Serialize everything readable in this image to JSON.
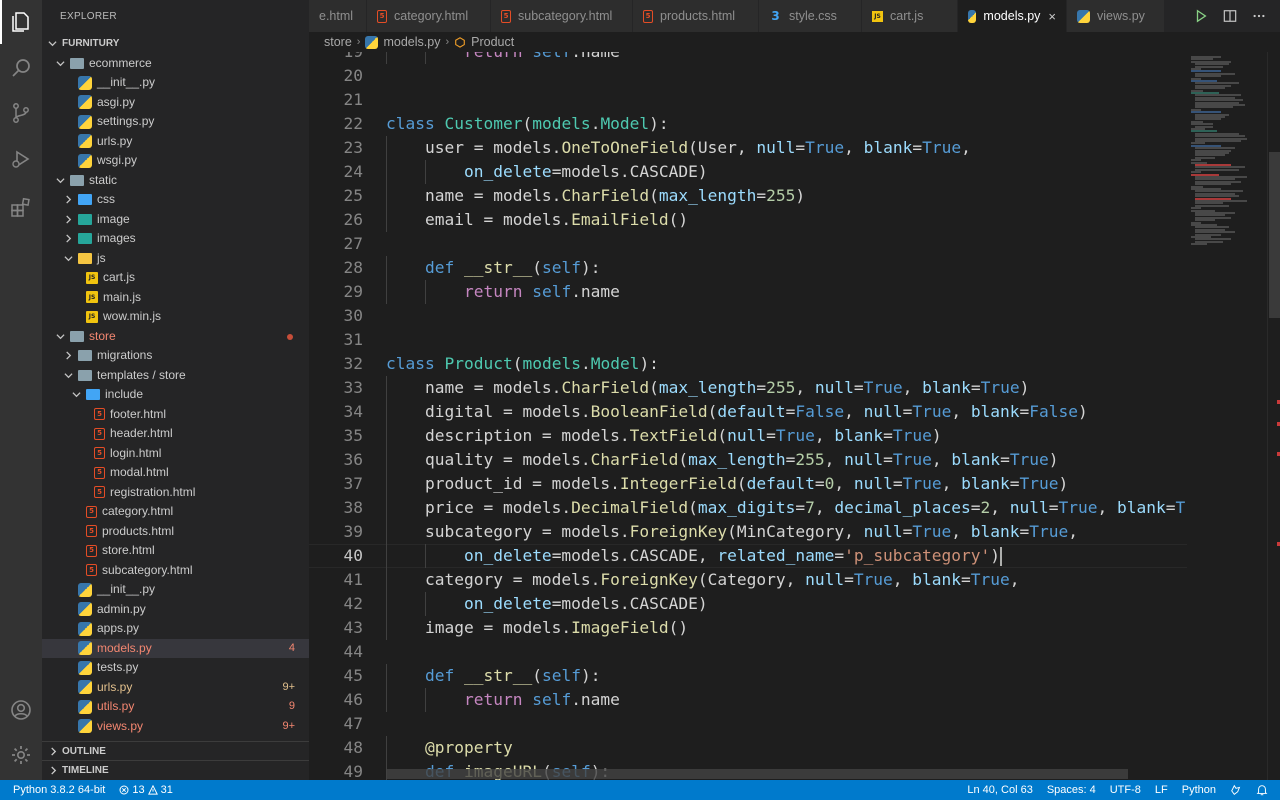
{
  "explorer": {
    "title": "EXPLORER",
    "tree": [
      {
        "label": "FURNITURY",
        "depth": 0,
        "type": "root",
        "open": true
      },
      {
        "label": "ecommerce",
        "depth": 1,
        "type": "folder",
        "icon": "folder-icon",
        "open": true
      },
      {
        "label": "__init__.py",
        "depth": 2,
        "type": "py"
      },
      {
        "label": "asgi.py",
        "depth": 2,
        "type": "py"
      },
      {
        "label": "settings.py",
        "depth": 2,
        "type": "py"
      },
      {
        "label": "urls.py",
        "depth": 2,
        "type": "py"
      },
      {
        "label": "wsgi.py",
        "depth": 2,
        "type": "py"
      },
      {
        "label": "static",
        "depth": 1,
        "type": "folder",
        "open": true
      },
      {
        "label": "css",
        "depth": 2,
        "type": "folder",
        "folder_color": "blue",
        "open": false
      },
      {
        "label": "image",
        "depth": 2,
        "type": "folder",
        "folder_color": "teal",
        "open": false
      },
      {
        "label": "images",
        "depth": 2,
        "type": "folder",
        "folder_color": "teal",
        "open": false
      },
      {
        "label": "js",
        "depth": 2,
        "type": "folder",
        "folder_color": "yellow",
        "open": true
      },
      {
        "label": "cart.js",
        "depth": 3,
        "type": "js"
      },
      {
        "label": "main.js",
        "depth": 3,
        "type": "js"
      },
      {
        "label": "wow.min.js",
        "depth": 3,
        "type": "js"
      },
      {
        "label": "store",
        "depth": 1,
        "type": "folder",
        "open": true,
        "status": "red",
        "dot": true
      },
      {
        "label": "migrations",
        "depth": 2,
        "type": "folder",
        "open": false
      },
      {
        "label": "templates / store",
        "depth": 2,
        "type": "folder",
        "open": true
      },
      {
        "label": "include",
        "depth": 3,
        "type": "folder",
        "folder_color": "blue",
        "open": true
      },
      {
        "label": "footer.html",
        "depth": 4,
        "type": "html"
      },
      {
        "label": "header.html",
        "depth": 4,
        "type": "html"
      },
      {
        "label": "login.html",
        "depth": 4,
        "type": "html"
      },
      {
        "label": "modal.html",
        "depth": 4,
        "type": "html"
      },
      {
        "label": "registration.html",
        "depth": 4,
        "type": "html"
      },
      {
        "label": "category.html",
        "depth": 3,
        "type": "html"
      },
      {
        "label": "products.html",
        "depth": 3,
        "type": "html"
      },
      {
        "label": "store.html",
        "depth": 3,
        "type": "html"
      },
      {
        "label": "subcategory.html",
        "depth": 3,
        "type": "html"
      },
      {
        "label": "__init__.py",
        "depth": 2,
        "type": "py"
      },
      {
        "label": "admin.py",
        "depth": 2,
        "type": "py"
      },
      {
        "label": "apps.py",
        "depth": 2,
        "type": "py"
      },
      {
        "label": "models.py",
        "depth": 2,
        "type": "py",
        "status": "red",
        "badge": "4",
        "selected": true
      },
      {
        "label": "tests.py",
        "depth": 2,
        "type": "py"
      },
      {
        "label": "urls.py",
        "depth": 2,
        "type": "py",
        "status": "yellow",
        "badge": "9+"
      },
      {
        "label": "utils.py",
        "depth": 2,
        "type": "py",
        "status": "red",
        "badge": "9"
      },
      {
        "label": "views.py",
        "depth": 2,
        "type": "py",
        "status": "red",
        "badge": "9+"
      }
    ],
    "sections": [
      {
        "label": "OUTLINE"
      },
      {
        "label": "TIMELINE"
      }
    ]
  },
  "tabs": [
    {
      "label": "e.html",
      "type": "html"
    },
    {
      "label": "category.html",
      "type": "html"
    },
    {
      "label": "subcategory.html",
      "type": "html"
    },
    {
      "label": "products.html",
      "type": "html"
    },
    {
      "label": "style.css",
      "type": "css"
    },
    {
      "label": "cart.js",
      "type": "js"
    },
    {
      "label": "models.py",
      "type": "py",
      "active": true
    },
    {
      "label": "views.py",
      "type": "py"
    }
  ],
  "breadcrumb": {
    "parts": [
      "store",
      "models.py",
      "Product"
    ]
  },
  "editor": {
    "current_line": 40,
    "lines": [
      {
        "n": 19,
        "tokens": [
          [
            "        ",
            ""
          ],
          [
            "return",
            "ctrl"
          ],
          [
            " ",
            ""
          ],
          [
            "self",
            "self"
          ],
          [
            ".name",
            ""
          ]
        ]
      },
      {
        "n": 20,
        "tokens": []
      },
      {
        "n": 21,
        "tokens": []
      },
      {
        "n": 22,
        "tokens": [
          [
            "class",
            "kw"
          ],
          [
            " ",
            ""
          ],
          [
            "Customer",
            "cls"
          ],
          [
            "(",
            ""
          ],
          [
            "models",
            "cls"
          ],
          [
            ".",
            ""
          ],
          [
            "Model",
            "cls"
          ],
          [
            "):",
            ""
          ]
        ]
      },
      {
        "n": 23,
        "tokens": [
          [
            "    user = models.",
            ""
          ],
          [
            "OneToOneField",
            "fn"
          ],
          [
            "(User, ",
            ""
          ],
          [
            "null",
            "par"
          ],
          [
            "=",
            ""
          ],
          [
            "True",
            "const"
          ],
          [
            ", ",
            ""
          ],
          [
            "blank",
            "par"
          ],
          [
            "=",
            ""
          ],
          [
            "True",
            "const"
          ],
          [
            ",",
            ""
          ]
        ]
      },
      {
        "n": 24,
        "tokens": [
          [
            "        ",
            ""
          ],
          [
            "on_delete",
            "par"
          ],
          [
            "=models.CASCADE)",
            ""
          ]
        ]
      },
      {
        "n": 25,
        "tokens": [
          [
            "    name = models.",
            ""
          ],
          [
            "CharField",
            "fn"
          ],
          [
            "(",
            ""
          ],
          [
            "max_length",
            "par"
          ],
          [
            "=",
            ""
          ],
          [
            "255",
            "num"
          ],
          [
            ")",
            ""
          ]
        ]
      },
      {
        "n": 26,
        "tokens": [
          [
            "    email = models.",
            ""
          ],
          [
            "EmailField",
            "fn"
          ],
          [
            "()",
            ""
          ]
        ]
      },
      {
        "n": 27,
        "tokens": []
      },
      {
        "n": 28,
        "tokens": [
          [
            "    ",
            ""
          ],
          [
            "def",
            "kw"
          ],
          [
            " ",
            ""
          ],
          [
            "__str__",
            "fn"
          ],
          [
            "(",
            ""
          ],
          [
            "self",
            "self"
          ],
          [
            "):",
            ""
          ]
        ]
      },
      {
        "n": 29,
        "tokens": [
          [
            "        ",
            ""
          ],
          [
            "return",
            "ctrl"
          ],
          [
            " ",
            ""
          ],
          [
            "self",
            "self"
          ],
          [
            ".name",
            ""
          ]
        ]
      },
      {
        "n": 30,
        "tokens": []
      },
      {
        "n": 31,
        "tokens": []
      },
      {
        "n": 32,
        "tokens": [
          [
            "class",
            "kw"
          ],
          [
            " ",
            ""
          ],
          [
            "Product",
            "cls"
          ],
          [
            "(",
            ""
          ],
          [
            "models",
            "cls"
          ],
          [
            ".",
            ""
          ],
          [
            "Model",
            "cls"
          ],
          [
            "):",
            ""
          ]
        ]
      },
      {
        "n": 33,
        "tokens": [
          [
            "    name = models.",
            ""
          ],
          [
            "CharField",
            "fn"
          ],
          [
            "(",
            ""
          ],
          [
            "max_length",
            "par"
          ],
          [
            "=",
            ""
          ],
          [
            "255",
            "num"
          ],
          [
            ", ",
            ""
          ],
          [
            "null",
            "par"
          ],
          [
            "=",
            ""
          ],
          [
            "True",
            "const"
          ],
          [
            ", ",
            ""
          ],
          [
            "blank",
            "par"
          ],
          [
            "=",
            ""
          ],
          [
            "True",
            "const"
          ],
          [
            ")",
            ""
          ]
        ]
      },
      {
        "n": 34,
        "tokens": [
          [
            "    digital = models.",
            ""
          ],
          [
            "BooleanField",
            "fn"
          ],
          [
            "(",
            ""
          ],
          [
            "default",
            "par"
          ],
          [
            "=",
            ""
          ],
          [
            "False",
            "const"
          ],
          [
            ", ",
            ""
          ],
          [
            "null",
            "par"
          ],
          [
            "=",
            ""
          ],
          [
            "True",
            "const"
          ],
          [
            ", ",
            ""
          ],
          [
            "blank",
            "par"
          ],
          [
            "=",
            ""
          ],
          [
            "False",
            "const"
          ],
          [
            ")",
            ""
          ]
        ]
      },
      {
        "n": 35,
        "tokens": [
          [
            "    description = models.",
            ""
          ],
          [
            "TextField",
            "fn"
          ],
          [
            "(",
            ""
          ],
          [
            "null",
            "par"
          ],
          [
            "=",
            ""
          ],
          [
            "True",
            "const"
          ],
          [
            ", ",
            ""
          ],
          [
            "blank",
            "par"
          ],
          [
            "=",
            ""
          ],
          [
            "True",
            "const"
          ],
          [
            ")",
            ""
          ]
        ]
      },
      {
        "n": 36,
        "tokens": [
          [
            "    quality = models.",
            ""
          ],
          [
            "CharField",
            "fn"
          ],
          [
            "(",
            ""
          ],
          [
            "max_length",
            "par"
          ],
          [
            "=",
            ""
          ],
          [
            "255",
            "num"
          ],
          [
            ", ",
            ""
          ],
          [
            "null",
            "par"
          ],
          [
            "=",
            ""
          ],
          [
            "True",
            "const"
          ],
          [
            ", ",
            ""
          ],
          [
            "blank",
            "par"
          ],
          [
            "=",
            ""
          ],
          [
            "True",
            "const"
          ],
          [
            ")",
            ""
          ]
        ]
      },
      {
        "n": 37,
        "tokens": [
          [
            "    product_id = models.",
            ""
          ],
          [
            "IntegerField",
            "fn"
          ],
          [
            "(",
            ""
          ],
          [
            "default",
            "par"
          ],
          [
            "=",
            ""
          ],
          [
            "0",
            "num"
          ],
          [
            ", ",
            ""
          ],
          [
            "null",
            "par"
          ],
          [
            "=",
            ""
          ],
          [
            "True",
            "const"
          ],
          [
            ", ",
            ""
          ],
          [
            "blank",
            "par"
          ],
          [
            "=",
            ""
          ],
          [
            "True",
            "const"
          ],
          [
            ")",
            ""
          ]
        ]
      },
      {
        "n": 38,
        "tokens": [
          [
            "    price = models.",
            ""
          ],
          [
            "DecimalField",
            "fn"
          ],
          [
            "(",
            ""
          ],
          [
            "max_digits",
            "par"
          ],
          [
            "=",
            ""
          ],
          [
            "7",
            "num"
          ],
          [
            ", ",
            ""
          ],
          [
            "decimal_places",
            "par"
          ],
          [
            "=",
            ""
          ],
          [
            "2",
            "num"
          ],
          [
            ", ",
            ""
          ],
          [
            "null",
            "par"
          ],
          [
            "=",
            ""
          ],
          [
            "True",
            "const"
          ],
          [
            ", ",
            ""
          ],
          [
            "blank",
            "par"
          ],
          [
            "=",
            ""
          ],
          [
            "Tr",
            "const"
          ]
        ]
      },
      {
        "n": 39,
        "tokens": [
          [
            "    subcategory = models.",
            ""
          ],
          [
            "ForeignKey",
            "fn"
          ],
          [
            "(MinCategory, ",
            ""
          ],
          [
            "null",
            "par"
          ],
          [
            "=",
            ""
          ],
          [
            "True",
            "const"
          ],
          [
            ", ",
            ""
          ],
          [
            "blank",
            "par"
          ],
          [
            "=",
            ""
          ],
          [
            "True",
            "const"
          ],
          [
            ",",
            ""
          ]
        ]
      },
      {
        "n": 40,
        "tokens": [
          [
            "        ",
            ""
          ],
          [
            "on_delete",
            "par"
          ],
          [
            "=models.CASCADE, ",
            ""
          ],
          [
            "related_name",
            "par"
          ],
          [
            "=",
            ""
          ],
          [
            "'p_subcategory'",
            "str"
          ],
          [
            ")",
            ""
          ]
        ],
        "cursor": true
      },
      {
        "n": 41,
        "tokens": [
          [
            "    category = models.",
            ""
          ],
          [
            "ForeignKey",
            "fn"
          ],
          [
            "(Category, ",
            ""
          ],
          [
            "null",
            "par"
          ],
          [
            "=",
            ""
          ],
          [
            "True",
            "const"
          ],
          [
            ", ",
            ""
          ],
          [
            "blank",
            "par"
          ],
          [
            "=",
            ""
          ],
          [
            "True",
            "const"
          ],
          [
            ",",
            ""
          ]
        ]
      },
      {
        "n": 42,
        "tokens": [
          [
            "        ",
            ""
          ],
          [
            "on_delete",
            "par"
          ],
          [
            "=models.CASCADE)",
            ""
          ]
        ]
      },
      {
        "n": 43,
        "tokens": [
          [
            "    image = models.",
            ""
          ],
          [
            "ImageField",
            "fn"
          ],
          [
            "()",
            ""
          ]
        ]
      },
      {
        "n": 44,
        "tokens": []
      },
      {
        "n": 45,
        "tokens": [
          [
            "    ",
            ""
          ],
          [
            "def",
            "kw"
          ],
          [
            " ",
            ""
          ],
          [
            "__str__",
            "fn"
          ],
          [
            "(",
            ""
          ],
          [
            "self",
            "self"
          ],
          [
            "):",
            ""
          ]
        ]
      },
      {
        "n": 46,
        "tokens": [
          [
            "        ",
            ""
          ],
          [
            "return",
            "ctrl"
          ],
          [
            " ",
            ""
          ],
          [
            "self",
            "self"
          ],
          [
            ".name",
            ""
          ]
        ]
      },
      {
        "n": 47,
        "tokens": []
      },
      {
        "n": 48,
        "tokens": [
          [
            "    ",
            ""
          ],
          [
            "@property",
            "dec"
          ]
        ]
      },
      {
        "n": 49,
        "tokens": [
          [
            "    ",
            ""
          ],
          [
            "def",
            "kw"
          ],
          [
            " ",
            ""
          ],
          [
            "imageURL",
            "fn"
          ],
          [
            "(",
            ""
          ],
          [
            "self",
            "self"
          ],
          [
            "):",
            ""
          ]
        ]
      }
    ]
  },
  "status": {
    "interpreter": "Python 3.8.2 64-bit",
    "errors": "13",
    "warnings": "31",
    "position": "Ln 40, Col 63",
    "spaces": "Spaces: 4",
    "encoding": "UTF-8",
    "eol": "LF",
    "language": "Python"
  },
  "colors": {
    "accent": "#007acc",
    "sidebar": "#252526",
    "editor": "#1e1e1e",
    "activity": "#333333",
    "error": "#f48771",
    "warning": "#e2c08d"
  }
}
